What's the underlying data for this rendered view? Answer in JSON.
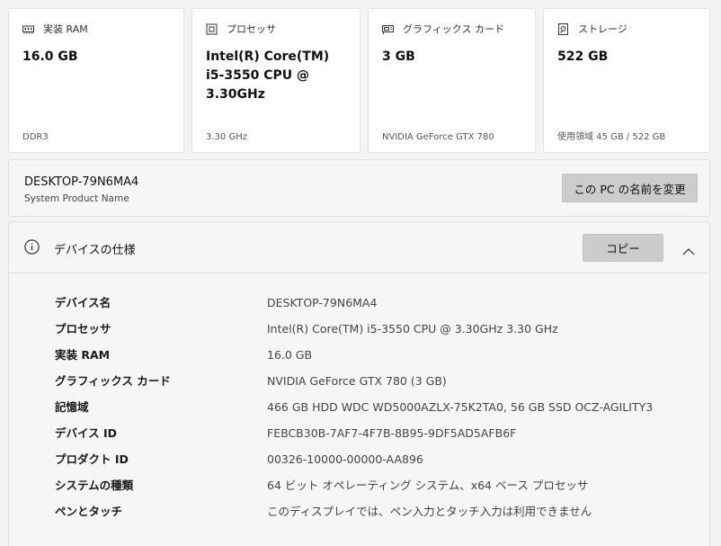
{
  "cards": [
    {
      "icon": "memory-icon",
      "title": "実装 RAM",
      "value": "16.0 GB",
      "sub": "DDR3"
    },
    {
      "icon": "processor-icon",
      "title": "プロセッサ",
      "value": "Intel(R) Core(TM) i5-3550 CPU @ 3.30GHz",
      "sub": "3.30 GHz"
    },
    {
      "icon": "graphics-card-icon",
      "title": "グラフィックス カード",
      "value": "3 GB",
      "sub": "NVIDIA GeForce GTX 780"
    },
    {
      "icon": "storage-icon",
      "title": "ストレージ",
      "value": "522 GB",
      "sub": "使用領域 45 GB / 522 GB"
    }
  ],
  "device": {
    "name": "DESKTOP-79N6MA4",
    "product": "System Product Name",
    "rename_label": "この PC の名前を変更"
  },
  "specs": {
    "title": "デバイスの仕様",
    "copy_label": "コピー",
    "rows": [
      {
        "label": "デバイス名",
        "value": "DESKTOP-79N6MA4"
      },
      {
        "label": "プロセッサ",
        "value": "Intel(R) Core(TM) i5-3550 CPU @ 3.30GHz   3.30 GHz"
      },
      {
        "label": "実装 RAM",
        "value": "16.0 GB"
      },
      {
        "label": "グラフィックス カード",
        "value": "NVIDIA GeForce GTX 780 (3 GB)"
      },
      {
        "label": "記憶域",
        "value": "466 GB HDD WDC WD5000AZLX-75K2TA0, 56 GB SSD OCZ-AGILITY3"
      },
      {
        "label": "デバイス ID",
        "value": "FEBCB30B-7AF7-4F7B-8B95-9DF5AD5AFB6F"
      },
      {
        "label": "プロダクト ID",
        "value": "00326-10000-00000-AA896"
      },
      {
        "label": "システムの種類",
        "value": "64 ビット オペレーティング システム、x64 ベース プロセッサ"
      },
      {
        "label": "ペンとタッチ",
        "value": "このディスプレイでは、ペン入力とタッチ入力は利用できません"
      }
    ]
  }
}
